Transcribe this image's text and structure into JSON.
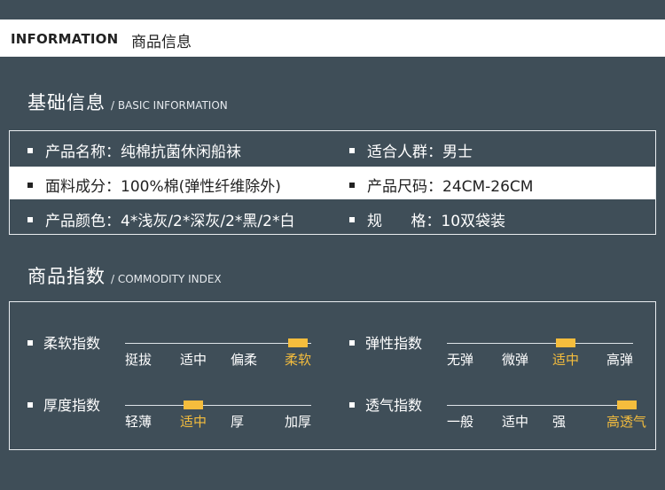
{
  "header": {
    "en": "INFORMATION",
    "zh": "商品信息"
  },
  "basic": {
    "title_zh": "基础信息",
    "title_en": "/ BASIC INFORMATION",
    "rows": [
      {
        "left": "产品名称：纯棉抗菌休闲船袜",
        "right": "适合人群：男士"
      },
      {
        "left": "面料成分：100%棉(弹性纤维除外)",
        "right": "产品尺码：24CM-26CM"
      },
      {
        "left": "产品颜色：4*浅灰/2*深灰/2*黑/2*白",
        "right": "规      格：10双袋装"
      }
    ]
  },
  "index": {
    "title_zh": "商品指数",
    "title_en": "/ COMMODITY INDEX",
    "items": [
      {
        "label": "柔软指数",
        "options": [
          "挺拔",
          "适中",
          "偏柔",
          "柔软"
        ],
        "selected": 3
      },
      {
        "label": "弹性指数",
        "options": [
          "无弹",
          "微弹",
          "适中",
          "高弹"
        ],
        "selected": 2
      },
      {
        "label": "厚度指数",
        "options": [
          "轻薄",
          "适中",
          "厚",
          "加厚"
        ],
        "selected": 1
      },
      {
        "label": "透气指数",
        "options": [
          "一般",
          "适中",
          "强",
          "高透气"
        ],
        "selected": 3
      }
    ]
  },
  "colors": {
    "background": "#3f4e58",
    "accent": "#f5bd3d",
    "band": "#ffffff"
  }
}
